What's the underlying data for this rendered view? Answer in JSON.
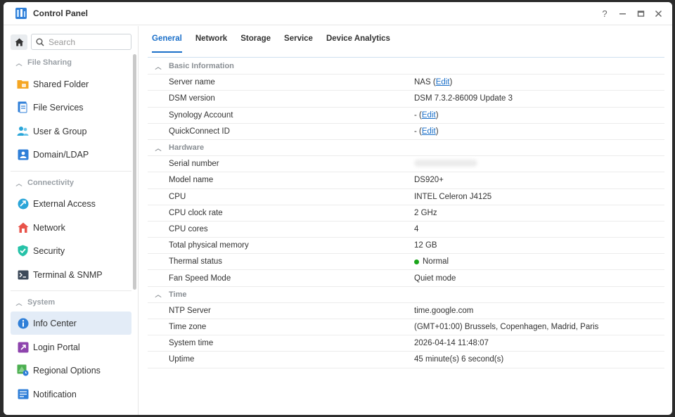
{
  "window": {
    "title": "Control Panel"
  },
  "search": {
    "placeholder": "Search"
  },
  "sidebar": {
    "sections": [
      {
        "label": "File Sharing"
      },
      {
        "label": "Connectivity"
      },
      {
        "label": "System"
      }
    ],
    "items": [
      {
        "label": "Shared Folder",
        "icon": "folder-icon"
      },
      {
        "label": "File Services",
        "icon": "file-services-icon"
      },
      {
        "label": "User & Group",
        "icon": "user-group-icon"
      },
      {
        "label": "Domain/LDAP",
        "icon": "domain-icon"
      },
      {
        "label": "External Access",
        "icon": "external-access-icon"
      },
      {
        "label": "Network",
        "icon": "network-icon"
      },
      {
        "label": "Security",
        "icon": "shield-icon"
      },
      {
        "label": "Terminal & SNMP",
        "icon": "terminal-icon"
      },
      {
        "label": "Info Center",
        "icon": "info-icon",
        "active": true
      },
      {
        "label": "Login Portal",
        "icon": "login-portal-icon"
      },
      {
        "label": "Regional Options",
        "icon": "regional-icon"
      },
      {
        "label": "Notification",
        "icon": "notification-icon"
      }
    ]
  },
  "tabs": [
    "General",
    "Network",
    "Storage",
    "Service",
    "Device Analytics"
  ],
  "info": {
    "basic": {
      "title": "Basic Information",
      "server_name_label": "Server name",
      "server_name_value": "NAS",
      "dsm_label": "DSM version",
      "dsm_value": "DSM 7.3.2-86009 Update 3",
      "account_label": "Synology Account",
      "account_value": "-",
      "quickconnect_label": "QuickConnect ID",
      "quickconnect_value": "-",
      "edit_label": "Edit"
    },
    "hardware": {
      "title": "Hardware",
      "serial_label": "Serial number",
      "model_label": "Model name",
      "model_value": "DS920+",
      "cpu_label": "CPU",
      "cpu_value": "INTEL Celeron J4125",
      "clock_label": "CPU clock rate",
      "clock_value": "2 GHz",
      "cores_label": "CPU cores",
      "cores_value": "4",
      "memory_label": "Total physical memory",
      "memory_value": "12 GB",
      "thermal_label": "Thermal status",
      "thermal_value": "Normal",
      "fan_label": "Fan Speed Mode",
      "fan_value": "Quiet mode"
    },
    "time": {
      "title": "Time",
      "ntp_label": "NTP Server",
      "ntp_value": "time.google.com",
      "zone_label": "Time zone",
      "zone_value": "(GMT+01:00) Brussels, Copenhagen, Madrid, Paris",
      "systime_label": "System time",
      "systime_value": "2026-04-14 11:48:07",
      "uptime_label": "Uptime",
      "uptime_value": "45 minute(s) 6 second(s)"
    }
  },
  "colors": {
    "accent": "#1a6fc9",
    "ok": "#1aa51a",
    "active_bg": "#e3ecf7"
  }
}
